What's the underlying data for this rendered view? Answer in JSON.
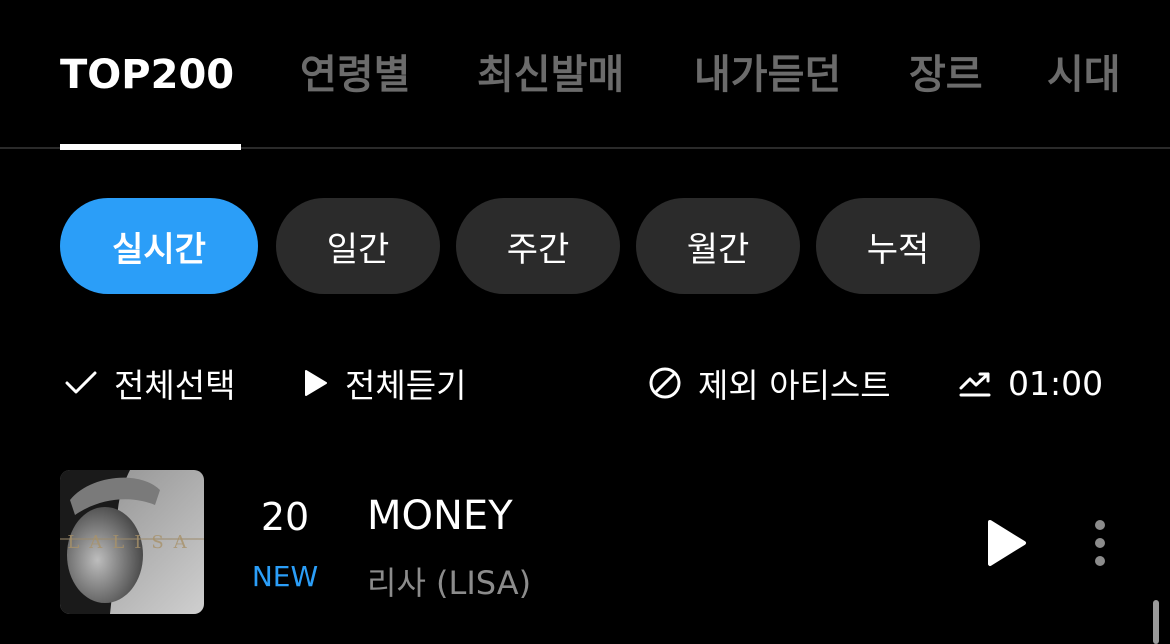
{
  "top_tabs": [
    "TOP200",
    "연령별",
    "최신발매",
    "내가듣던",
    "장르",
    "시대"
  ],
  "period_chips": [
    "실시간",
    "일간",
    "주간",
    "월간",
    "누적"
  ],
  "actions": {
    "select_all": "전체선택",
    "play_all": "전체듣기",
    "excluded_artists": "제외 아티스트",
    "chart_time": "01:00"
  },
  "song": {
    "rank": "20",
    "badge": "NEW",
    "title": "MONEY",
    "artist": "리사 (LISA)",
    "album_art_text": "LALISA"
  },
  "colors": {
    "accent": "#2b9ef8",
    "background": "#000000",
    "chip": "#2b2b2b",
    "inactive_tab": "#6b6b6b",
    "secondary_text": "#8c8c8c"
  },
  "icons": {
    "select_all": "check-icon",
    "play_all": "play-icon",
    "excluded_artists": "block-icon",
    "chart_time": "trend-icon",
    "song_play": "play-icon",
    "song_more": "more-vertical-icon"
  }
}
